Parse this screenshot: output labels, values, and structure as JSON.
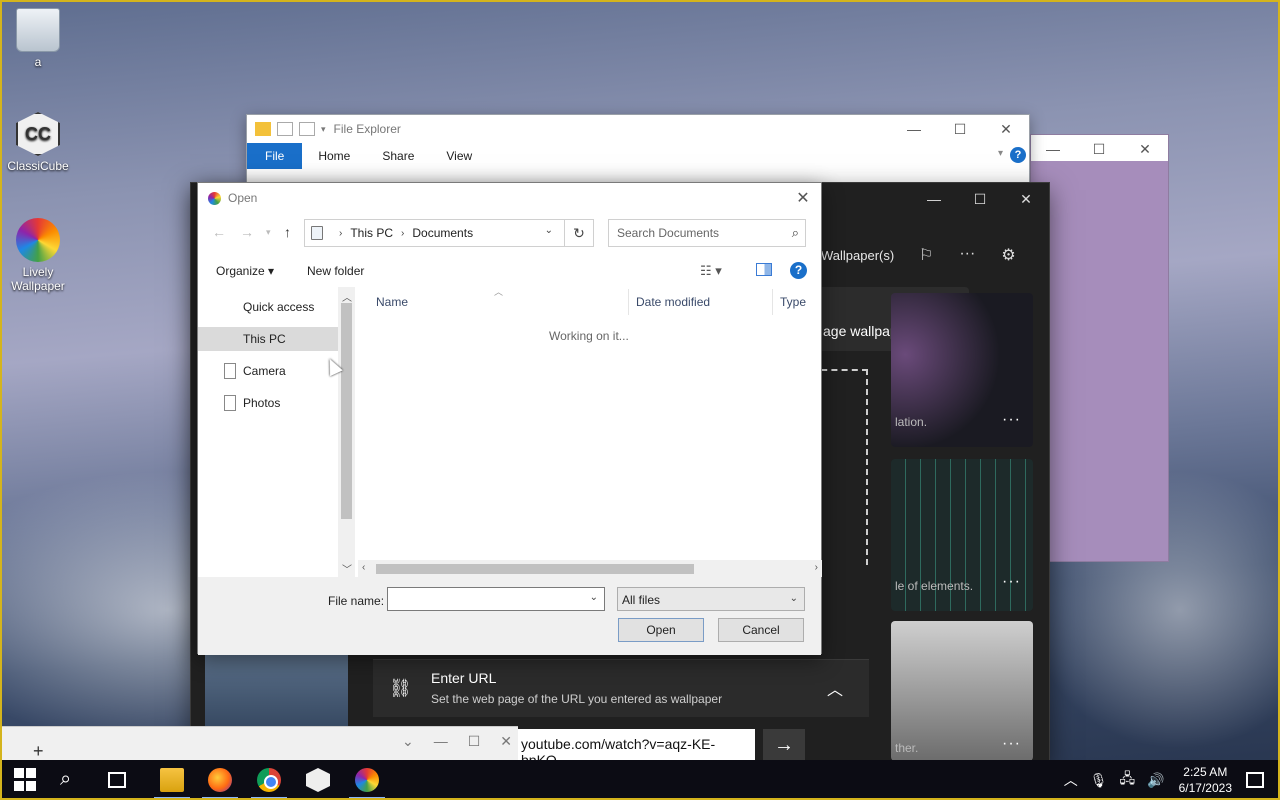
{
  "desktop": {
    "icons": [
      {
        "label": "a",
        "icon": "recycle-bin-icon"
      },
      {
        "label": "ClassiCube",
        "icon": "classicube-icon"
      },
      {
        "label": "Lively Wallpaper",
        "icon": "lively-wallpaper-icon"
      }
    ]
  },
  "file_explorer": {
    "title": "File Explorer",
    "tabs": [
      "File",
      "Home",
      "Share",
      "View"
    ]
  },
  "lively": {
    "wallpapers_label": "Wallpaper(s)",
    "banner_text": "age wallpapers",
    "card_captions": [
      "lation.",
      "le of elements.",
      "ther."
    ],
    "enter_url_title": "Enter URL",
    "enter_url_desc": "Set the web page of the URL you entered as wallpaper",
    "url_value": "youtube.com/watch?v=aqz-KE-bpKQ"
  },
  "dialog": {
    "title": "Open",
    "address": [
      "This PC",
      "Documents"
    ],
    "search_placeholder": "Search Documents",
    "organize_label": "Organize",
    "new_folder_label": "New folder",
    "nav_items": [
      {
        "label": "Quick access",
        "selected": false
      },
      {
        "label": "This PC",
        "selected": true
      },
      {
        "label": "Camera",
        "selected": false
      },
      {
        "label": "Photos",
        "selected": false
      }
    ],
    "columns": [
      "Name",
      "Date modified",
      "Type"
    ],
    "status": "Working on it...",
    "file_name_label": "File name:",
    "file_name_value": "",
    "file_type": "All files",
    "open_label": "Open",
    "cancel_label": "Cancel"
  },
  "taskbar": {
    "time": "2:25 AM",
    "date": "6/17/2023"
  }
}
